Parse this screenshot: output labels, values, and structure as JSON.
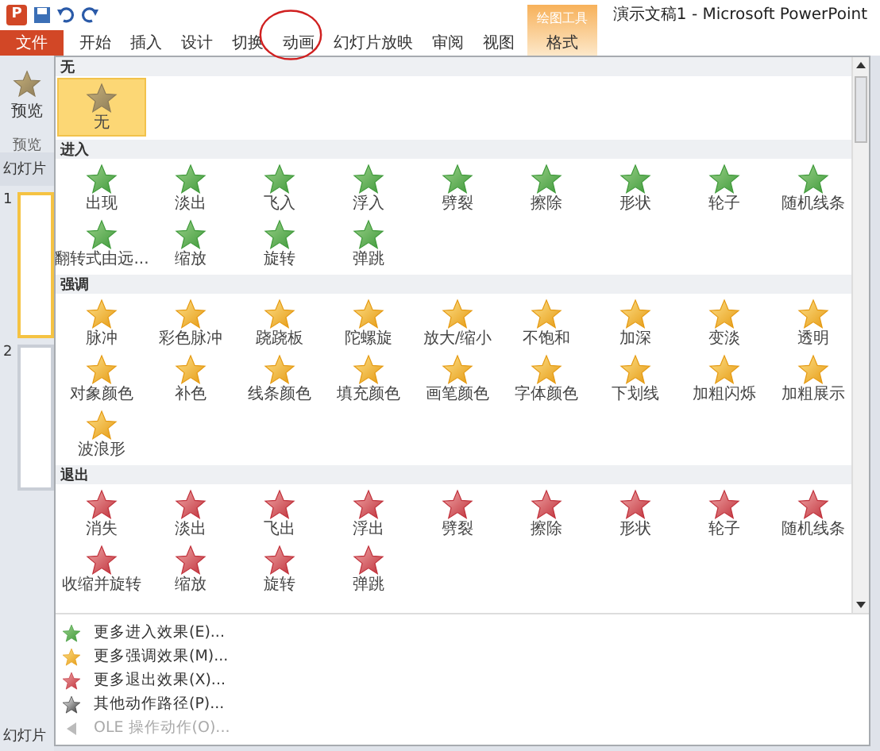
{
  "window": {
    "title": "演示文稿1 - Microsoft PowerPoint",
    "app_icon": "P"
  },
  "tabs": [
    {
      "label": "文件",
      "kind": "file"
    },
    {
      "label": "开始",
      "kind": "tab"
    },
    {
      "label": "插入",
      "kind": "tab"
    },
    {
      "label": "设计",
      "kind": "tab"
    },
    {
      "label": "切换",
      "kind": "tab"
    },
    {
      "label": "动画",
      "kind": "tab"
    },
    {
      "label": "幻灯片放映",
      "kind": "tab"
    },
    {
      "label": "审阅",
      "kind": "tab"
    },
    {
      "label": "视图",
      "kind": "tab"
    }
  ],
  "contextual_tab": {
    "group": "绘图工具",
    "label": "格式"
  },
  "ribbon": {
    "preview_button": "预览",
    "group_label": "预览"
  },
  "slides_pane": {
    "tab": "幻灯片",
    "slides": [
      {
        "number": "1",
        "selected": true
      },
      {
        "number": "2",
        "selected": false
      }
    ]
  },
  "status_bar": "幻灯片",
  "gallery": {
    "sections": [
      {
        "title": "无",
        "kind": "none",
        "items": [
          {
            "label": "无",
            "selected": true
          }
        ]
      },
      {
        "title": "进入",
        "kind": "entrance",
        "items": [
          {
            "label": "出现",
            "selected": false
          },
          {
            "label": "淡出",
            "selected": false
          },
          {
            "label": "飞入",
            "selected": false
          },
          {
            "label": "浮入",
            "selected": false
          },
          {
            "label": "劈裂",
            "selected": false
          },
          {
            "label": "擦除",
            "selected": false
          },
          {
            "label": "形状",
            "selected": false
          },
          {
            "label": "轮子",
            "selected": false
          },
          {
            "label": "随机线条",
            "selected": false
          },
          {
            "label": "翻转式由远...",
            "selected": false
          },
          {
            "label": "缩放",
            "selected": false
          },
          {
            "label": "旋转",
            "selected": false
          },
          {
            "label": "弹跳",
            "selected": false
          }
        ]
      },
      {
        "title": "强调",
        "kind": "emphasis",
        "items": [
          {
            "label": "脉冲",
            "selected": false
          },
          {
            "label": "彩色脉冲",
            "selected": false
          },
          {
            "label": "跷跷板",
            "selected": false
          },
          {
            "label": "陀螺旋",
            "selected": false
          },
          {
            "label": "放大/缩小",
            "selected": false
          },
          {
            "label": "不饱和",
            "selected": false
          },
          {
            "label": "加深",
            "selected": false
          },
          {
            "label": "变淡",
            "selected": false
          },
          {
            "label": "透明",
            "selected": false
          },
          {
            "label": "对象颜色",
            "selected": false
          },
          {
            "label": "补色",
            "selected": false
          },
          {
            "label": "线条颜色",
            "selected": false
          },
          {
            "label": "填充颜色",
            "selected": false
          },
          {
            "label": "画笔颜色",
            "selected": false
          },
          {
            "label": "字体颜色",
            "selected": false
          },
          {
            "label": "下划线",
            "selected": false
          },
          {
            "label": "加粗闪烁",
            "selected": false
          },
          {
            "label": "加粗展示",
            "selected": false
          },
          {
            "label": "波浪形",
            "selected": false
          }
        ]
      },
      {
        "title": "退出",
        "kind": "exit",
        "items": [
          {
            "label": "消失",
            "selected": false
          },
          {
            "label": "淡出",
            "selected": false
          },
          {
            "label": "飞出",
            "selected": false
          },
          {
            "label": "浮出",
            "selected": false
          },
          {
            "label": "劈裂",
            "selected": false
          },
          {
            "label": "擦除",
            "selected": false
          },
          {
            "label": "形状",
            "selected": false
          },
          {
            "label": "轮子",
            "selected": false
          },
          {
            "label": "随机线条",
            "selected": false
          },
          {
            "label": "收缩并旋转",
            "selected": false
          },
          {
            "label": "缩放",
            "selected": false
          },
          {
            "label": "旋转",
            "selected": false
          },
          {
            "label": "弹跳",
            "selected": false
          }
        ]
      }
    ]
  },
  "menu": [
    {
      "label": "更多进入效果(E)...",
      "kind": "entrance",
      "disabled": false
    },
    {
      "label": "更多强调效果(M)...",
      "kind": "emphasis",
      "disabled": false
    },
    {
      "label": "更多退出效果(X)...",
      "kind": "exit",
      "disabled": false
    },
    {
      "label": "其他动作路径(P)...",
      "kind": "path",
      "disabled": false
    },
    {
      "label": "OLE 操作动作(O)...",
      "kind": "ole",
      "disabled": true
    }
  ]
}
